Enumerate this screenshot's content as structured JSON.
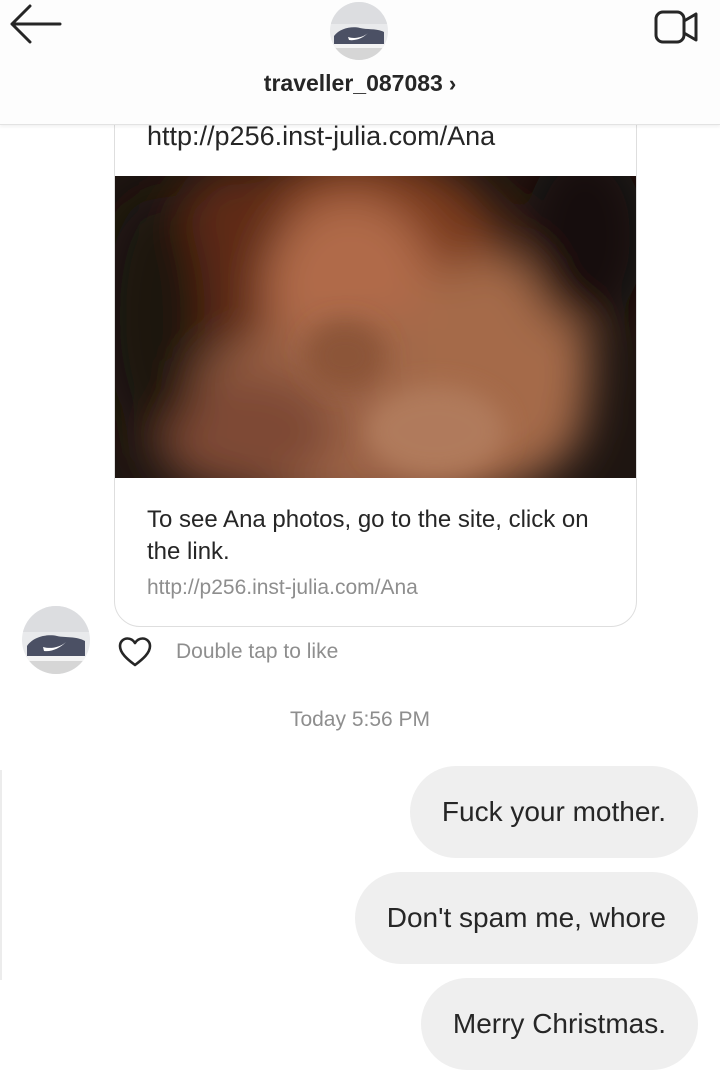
{
  "header": {
    "username": "traveller_087083",
    "chevron": "›",
    "back_icon": "arrow-left-icon",
    "video_icon": "video-camera-icon"
  },
  "shared_link": {
    "url_title": "http://p256.inst-julia.com/Ana",
    "description": "To see Ana photos, go to the site, click on the link.",
    "url": "http://p256.inst-julia.com/Ana"
  },
  "reaction": {
    "like_icon": "heart-outline-icon",
    "double_tap_label": "Double tap to like"
  },
  "timestamp": "Today 5:56 PM",
  "outgoing_messages": [
    {
      "text": "Fuck your mother."
    },
    {
      "text": "Don't spam me, whore"
    },
    {
      "text": "Merry Christmas."
    }
  ],
  "colors": {
    "bubble_bg": "#efefef",
    "secondary_text": "#8e8e8e",
    "primary_text": "#262626"
  }
}
